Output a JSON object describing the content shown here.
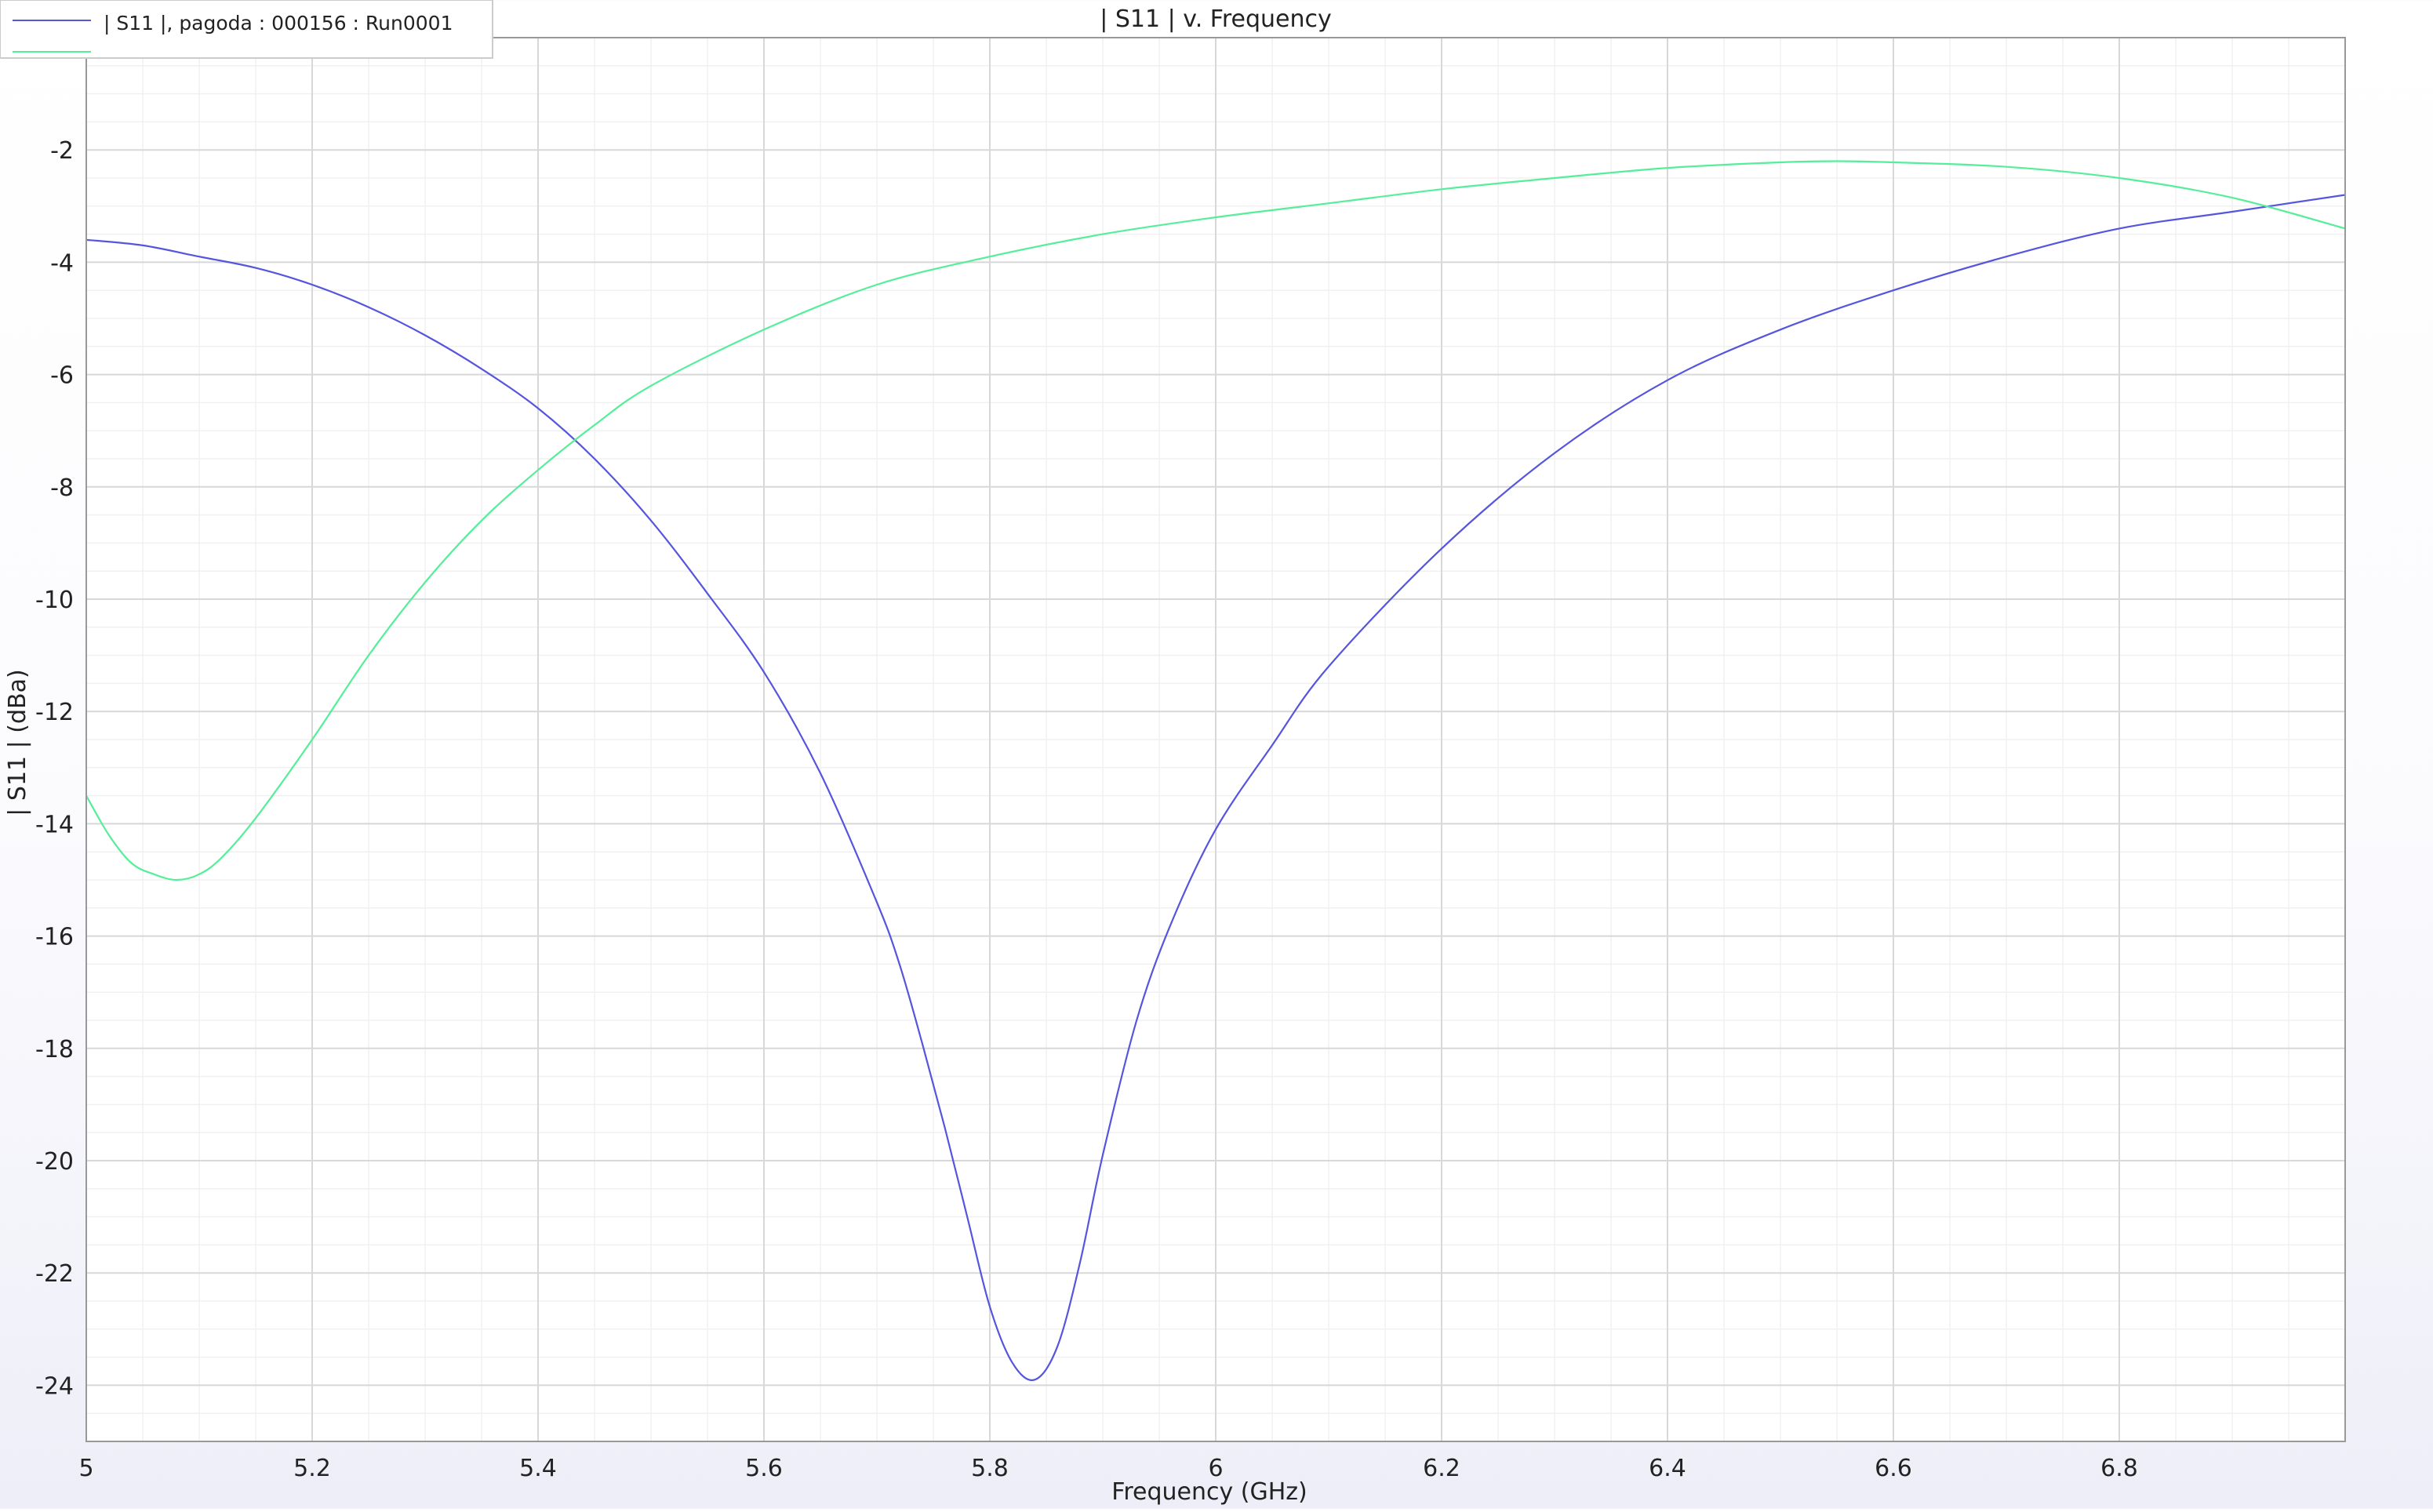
{
  "chart_data": {
    "type": "line",
    "title": "| S11 | v. Frequency",
    "xlabel": "Frequency (GHz)",
    "ylabel": "| S11 | (dBa)",
    "xlim": [
      5.0,
      7.0
    ],
    "ylim": [
      -25.0,
      0.0
    ],
    "x_ticks": [
      5,
      5.2,
      5.4,
      5.6,
      5.8,
      6,
      6.2,
      6.4,
      6.6,
      6.8
    ],
    "x_tick_labels": [
      "5",
      "5.2",
      "5.4",
      "5.6",
      "5.8",
      "6",
      "6.2",
      "6.4",
      "6.6",
      "6.8"
    ],
    "y_ticks": [
      0,
      -2,
      -4,
      -6,
      -8,
      -10,
      -12,
      -14,
      -16,
      -18,
      -20,
      -22,
      -24
    ],
    "y_tick_labels": [
      "0",
      "-2",
      "-4",
      "-6",
      "-8",
      "-10",
      "-12",
      "-14",
      "-16",
      "-18",
      "-20",
      "-22",
      "-24"
    ],
    "grid": true,
    "legend_position": "top-left",
    "series": [
      {
        "name": "| S11 |, pagoda : 000156 : Run0001",
        "color": "#5555dd",
        "x": [
          5.0,
          5.05,
          5.1,
          5.15,
          5.2,
          5.25,
          5.3,
          5.35,
          5.4,
          5.45,
          5.5,
          5.55,
          5.6,
          5.65,
          5.7,
          5.72,
          5.74,
          5.76,
          5.78,
          5.8,
          5.82,
          5.84,
          5.86,
          5.88,
          5.9,
          5.93,
          5.96,
          6.0,
          6.05,
          6.1,
          6.2,
          6.3,
          6.4,
          6.5,
          6.6,
          6.7,
          6.8,
          6.9,
          7.0
        ],
        "y": [
          -3.6,
          -3.7,
          -3.9,
          -4.1,
          -4.4,
          -4.8,
          -5.3,
          -5.9,
          -6.6,
          -7.5,
          -8.6,
          -9.9,
          -11.3,
          -13.1,
          -15.4,
          -16.5,
          -17.9,
          -19.4,
          -21.0,
          -22.6,
          -23.6,
          -23.9,
          -23.3,
          -21.8,
          -19.9,
          -17.5,
          -15.8,
          -14.1,
          -12.6,
          -11.2,
          -9.1,
          -7.4,
          -6.1,
          -5.2,
          -4.5,
          -3.9,
          -3.4,
          -3.1,
          -2.8
        ]
      },
      {
        "name": "",
        "color": "#55ee99",
        "x": [
          5.0,
          5.02,
          5.04,
          5.06,
          5.08,
          5.1,
          5.12,
          5.15,
          5.2,
          5.25,
          5.3,
          5.35,
          5.4,
          5.45,
          5.5,
          5.6,
          5.7,
          5.8,
          5.9,
          6.0,
          6.1,
          6.2,
          6.3,
          6.4,
          6.5,
          6.55,
          6.6,
          6.7,
          6.8,
          6.9,
          7.0
        ],
        "y": [
          -13.5,
          -14.2,
          -14.7,
          -14.9,
          -15.0,
          -14.9,
          -14.6,
          -13.9,
          -12.5,
          -11.0,
          -9.7,
          -8.6,
          -7.7,
          -6.9,
          -6.2,
          -5.2,
          -4.4,
          -3.9,
          -3.5,
          -3.2,
          -2.95,
          -2.7,
          -2.5,
          -2.32,
          -2.22,
          -2.2,
          -2.22,
          -2.3,
          -2.5,
          -2.85,
          -3.4
        ]
      }
    ]
  }
}
